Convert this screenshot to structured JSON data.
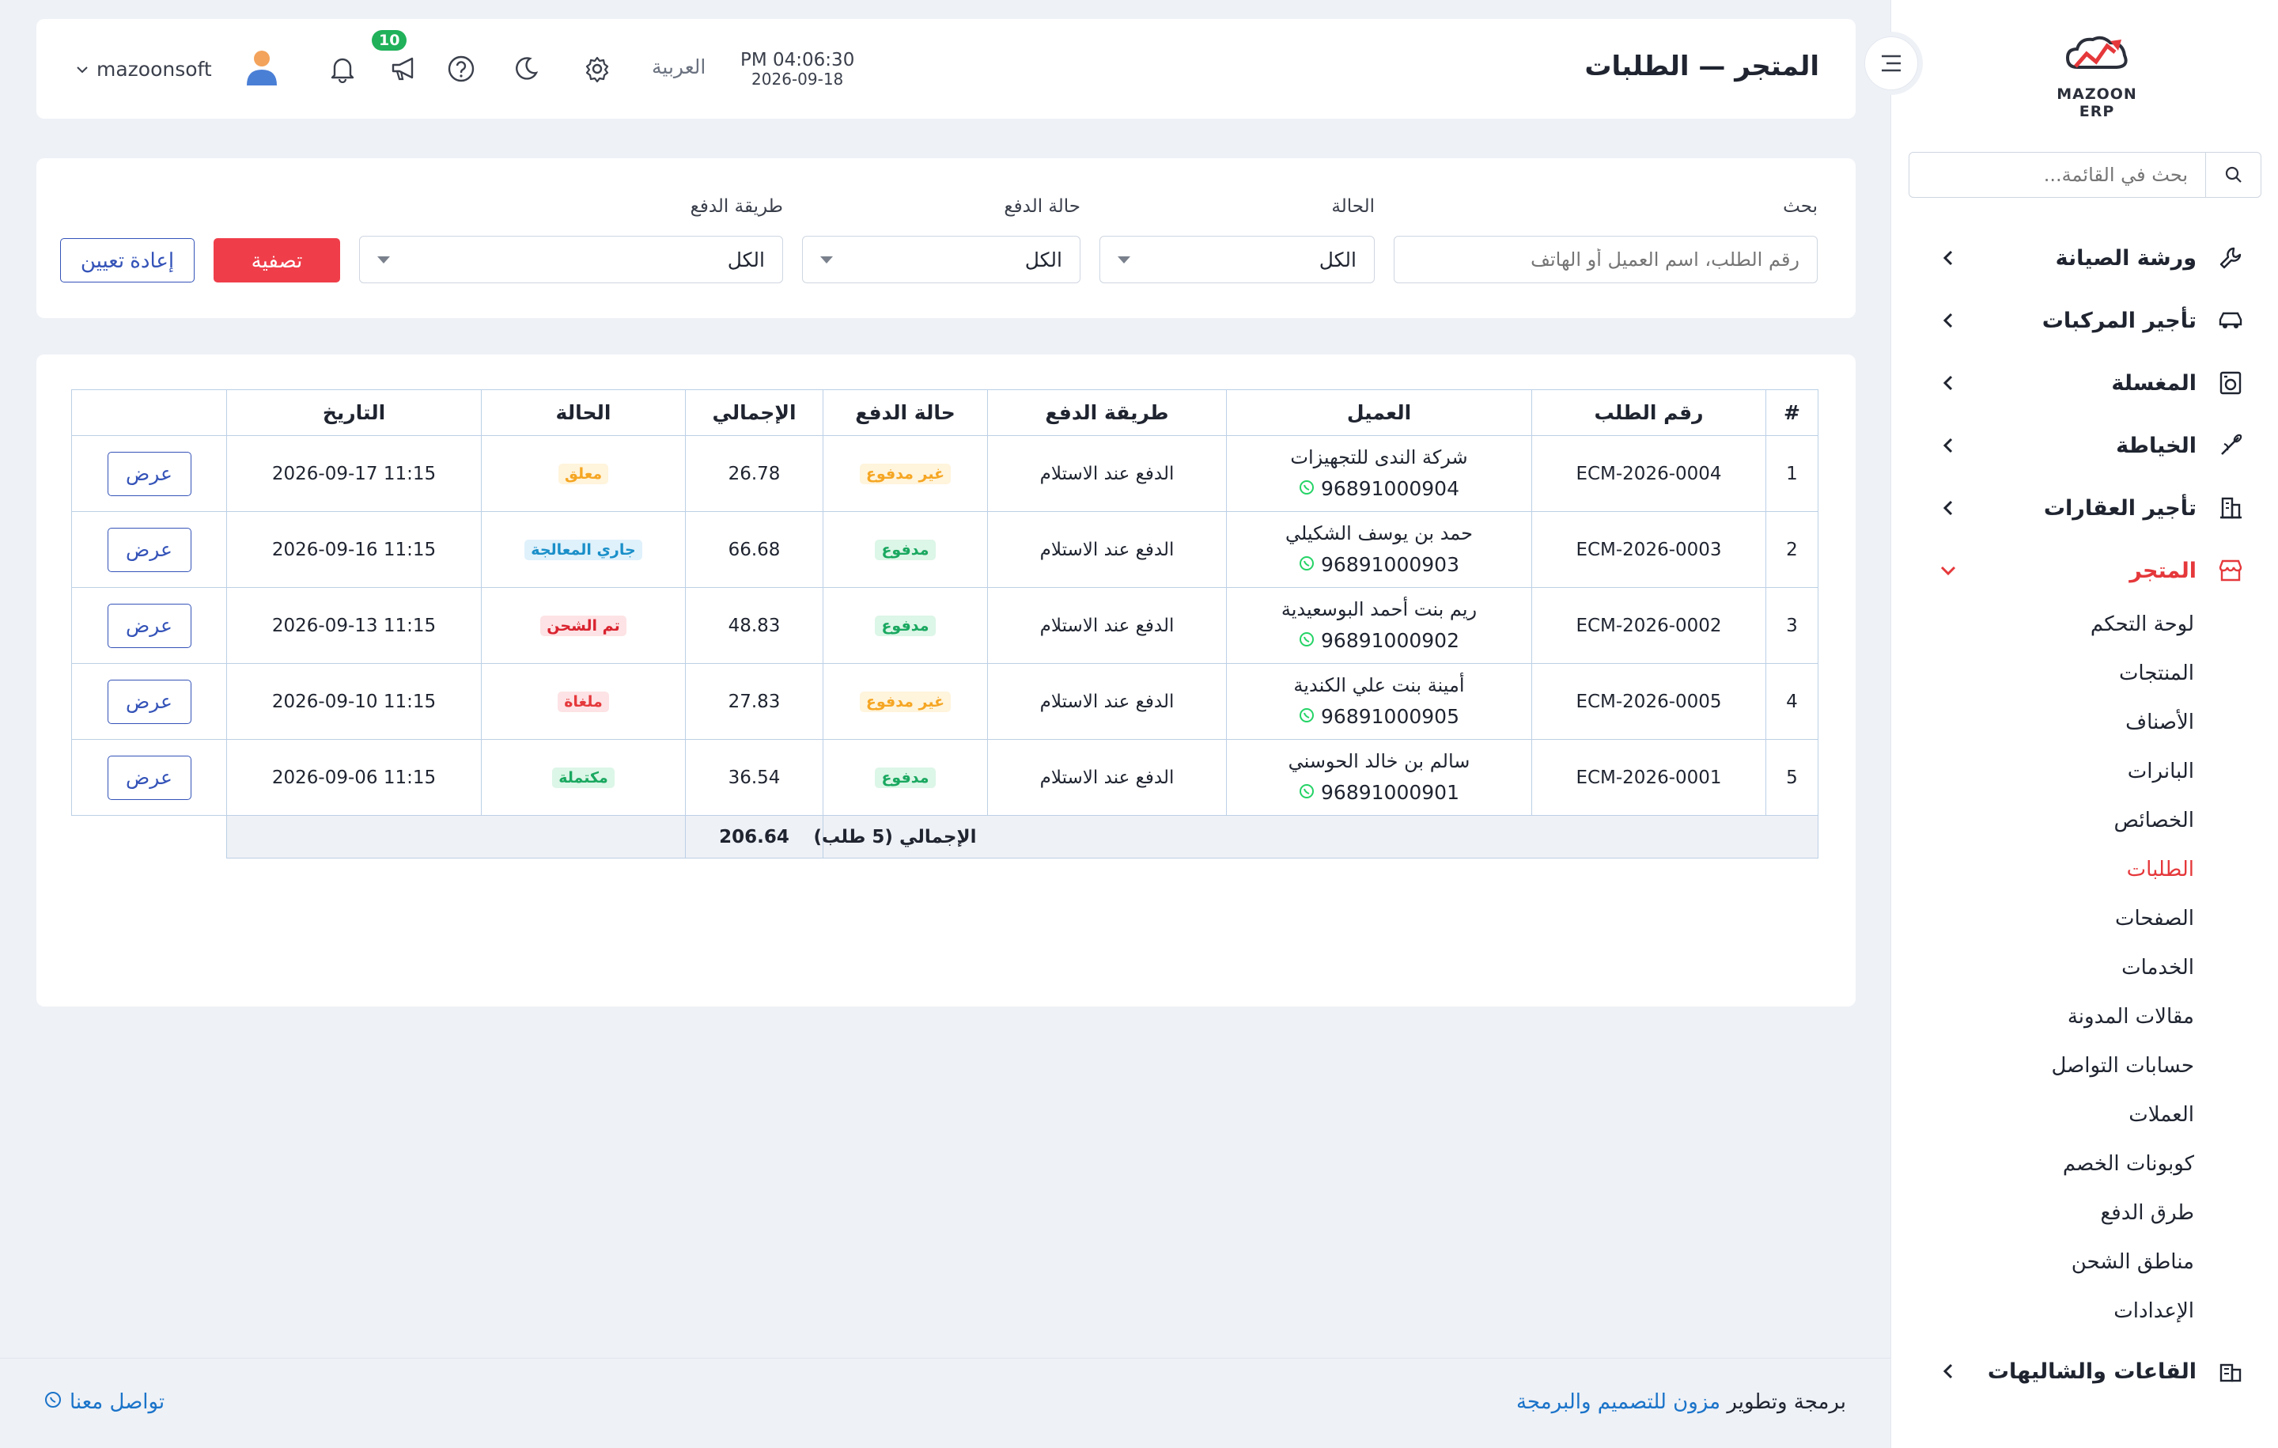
{
  "sidebar": {
    "logo_text": "MAZOON ERP",
    "search_placeholder": "بحث في القائمة...",
    "items": [
      {
        "label": "ورشة الصيانة",
        "icon": "wrench-icon"
      },
      {
        "label": "تأجير المركبات",
        "icon": "car-icon"
      },
      {
        "label": "المغسلة",
        "icon": "washer-icon"
      },
      {
        "label": "الخياطة",
        "icon": "needle-icon"
      },
      {
        "label": "تأجير العقارات",
        "icon": "building-icon"
      },
      {
        "label": "المتجر",
        "icon": "store-icon",
        "expanded": true
      },
      {
        "label": "القاعات والشاليهات",
        "icon": "hall-icon"
      }
    ],
    "store_subitems": [
      "لوحة التحكم",
      "المنتجات",
      "الأصناف",
      "البانرات",
      "الخصائص",
      "الطلبات",
      "الصفحات",
      "الخدمات",
      "مقالات المدونة",
      "حسابات التواصل",
      "العملات",
      "كوبونات الخصم",
      "طرق الدفع",
      "مناطق الشحن",
      "الإعدادات"
    ],
    "active_subitem": "الطلبات"
  },
  "header": {
    "title": "المتجر — الطلبات",
    "time": "PM 04:06:30",
    "date": "2026-09-18",
    "language": "العربية",
    "notification_count": "10",
    "username": "mazoonsoft"
  },
  "filters": {
    "search_label": "بحث",
    "search_placeholder": "رقم الطلب، اسم العميل أو الهاتف",
    "status_label": "الحالة",
    "status_value": "الكل",
    "payment_status_label": "حالة الدفع",
    "payment_status_value": "الكل",
    "payment_method_label": "طريقة الدفع",
    "payment_method_value": "الكل",
    "filter_button": "تصفية",
    "reset_button": "إعادة تعيين"
  },
  "table": {
    "columns": [
      "#",
      "رقم الطلب",
      "العميل",
      "طريقة الدفع",
      "حالة الدفع",
      "الإجمالي",
      "الحالة",
      "التاريخ",
      ""
    ],
    "rows": [
      {
        "n": "1",
        "order": "ECM-2026-0004",
        "customer": "شركة الندى للتجهيزات",
        "phone": "96891000904",
        "method": "الدفع عند الاستلام",
        "pay_status": "غير مدفوع",
        "pay_color": "#f5a623",
        "pay_bg": "#fff4dc",
        "total": "26.78",
        "status": "معلق",
        "status_color": "#f5a623",
        "status_bg": "#fff4dc",
        "date": "2026-09-17 11:15",
        "action": "عرض"
      },
      {
        "n": "2",
        "order": "ECM-2026-0003",
        "customer": "حمد بن يوسف الشكيلي",
        "phone": "96891000903",
        "method": "الدفع عند الاستلام",
        "pay_status": "مدفوع",
        "pay_color": "#1aa860",
        "pay_bg": "#dcf6e7",
        "total": "66.68",
        "status": "جاري المعالجة",
        "status_color": "#1a8fc9",
        "status_bg": "#dff1fb",
        "date": "2026-09-16 11:15",
        "action": "عرض"
      },
      {
        "n": "3",
        "order": "ECM-2026-0002",
        "customer": "ريم بنت أحمد البوسعيدية",
        "phone": "96891000902",
        "method": "الدفع عند الاستلام",
        "pay_status": "مدفوع",
        "pay_color": "#1aa860",
        "pay_bg": "#dcf6e7",
        "total": "48.83",
        "status": "تم الشحن",
        "status_color": "#d9232f",
        "status_bg": "#fde3e5",
        "date": "2026-09-13 11:15",
        "action": "عرض"
      },
      {
        "n": "4",
        "order": "ECM-2026-0005",
        "customer": "أمينة بنت علي الكندية",
        "phone": "96891000905",
        "method": "الدفع عند الاستلام",
        "pay_status": "غير مدفوع",
        "pay_color": "#f5a623",
        "pay_bg": "#fff4dc",
        "total": "27.83",
        "status": "ملغاة",
        "status_color": "#e5383b",
        "status_bg": "#fde3e5",
        "date": "2026-09-10 11:15",
        "action": "عرض"
      },
      {
        "n": "5",
        "order": "ECM-2026-0001",
        "customer": "سالم بن خالد الحوسني",
        "phone": "96891000901",
        "method": "الدفع عند الاستلام",
        "pay_status": "مدفوع",
        "pay_color": "#1aa860",
        "pay_bg": "#dcf6e7",
        "total": "36.54",
        "status": "مكتملة",
        "status_color": "#1aa860",
        "status_bg": "#dcf6e7",
        "date": "2026-09-06 11:15",
        "action": "عرض"
      }
    ],
    "total_label": "الإجمالي (5 طلب)",
    "total_value": "206.64"
  },
  "footer": {
    "credit_prefix": "برمجة وتطوير",
    "credit_link": "مزون للتصميم والبرمجة",
    "contact": "تواصل معنا"
  },
  "colors": {
    "accent": "#e5383b",
    "primary": "#3453b8",
    "link": "#1a73c9"
  }
}
